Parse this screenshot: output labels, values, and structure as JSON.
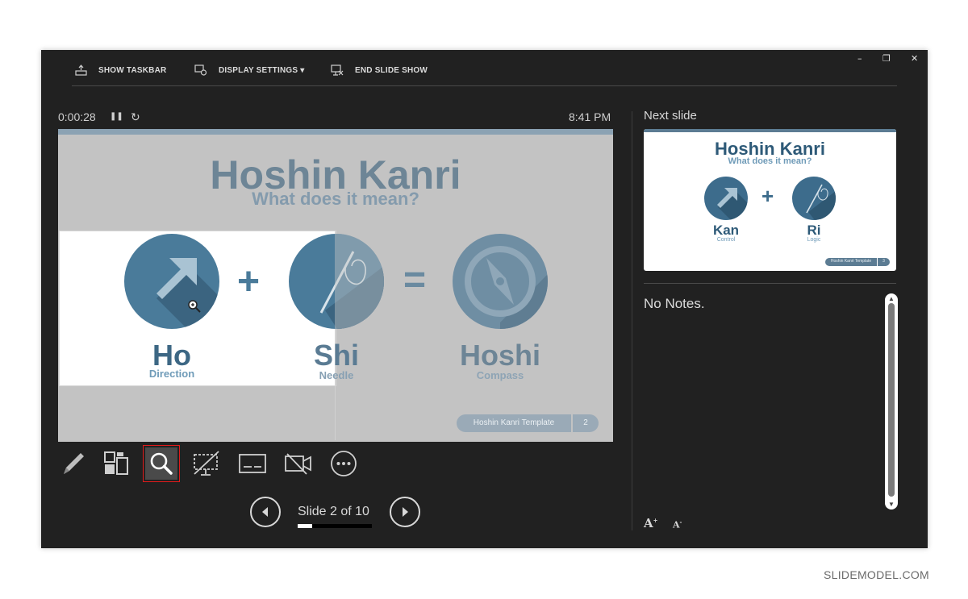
{
  "window": {
    "minimize": "–",
    "restore": "❐",
    "close": "✕"
  },
  "toolbar": {
    "show_taskbar": "SHOW TASKBAR",
    "display_settings": "DISPLAY SETTINGS ▾",
    "end_slide_show": "END SLIDE SHOW"
  },
  "presenter": {
    "elapsed": "0:00:28",
    "pause": "❚❚",
    "reset": "↻",
    "clock": "8:41 PM"
  },
  "current_slide": {
    "title": "Hoshin Kanri",
    "subtitle": "What does it mean?",
    "plus": "+",
    "equals": "=",
    "terms": [
      {
        "word": "Ho",
        "meaning": "Direction"
      },
      {
        "word": "Shi",
        "meaning": "Needle"
      },
      {
        "word": "Hoshi",
        "meaning": "Compass"
      }
    ],
    "footer_label": "Hoshin Kanri Template",
    "footer_number": "2"
  },
  "tools": [
    "pen-tool",
    "see-all-slides",
    "zoom-into-slide",
    "black-white-screen",
    "toggle-subtitles",
    "camera",
    "more-options"
  ],
  "navigation": {
    "slide_counter": "Slide 2 of 10",
    "progress": 0.2
  },
  "next_slide": {
    "label": "Next slide",
    "title": "Hoshin Kanri",
    "subtitle": "What does it mean?",
    "plus": "+",
    "terms": [
      {
        "word": "Kan",
        "meaning": "Control"
      },
      {
        "word": "Ri",
        "meaning": "Logic"
      }
    ],
    "footer_label": "Hoshin Kanri Template",
    "footer_number": "3"
  },
  "notes": {
    "text": "No Notes.",
    "increase_font": "A",
    "decrease_font": "A"
  },
  "watermark": "SLIDEMODEL.COM",
  "colors": {
    "window_bg": "#212121",
    "slide_title": "#6d8596",
    "circle": "#4a7b9a",
    "thumb_title": "#2e5a78",
    "highlight": "#e01b1b"
  }
}
